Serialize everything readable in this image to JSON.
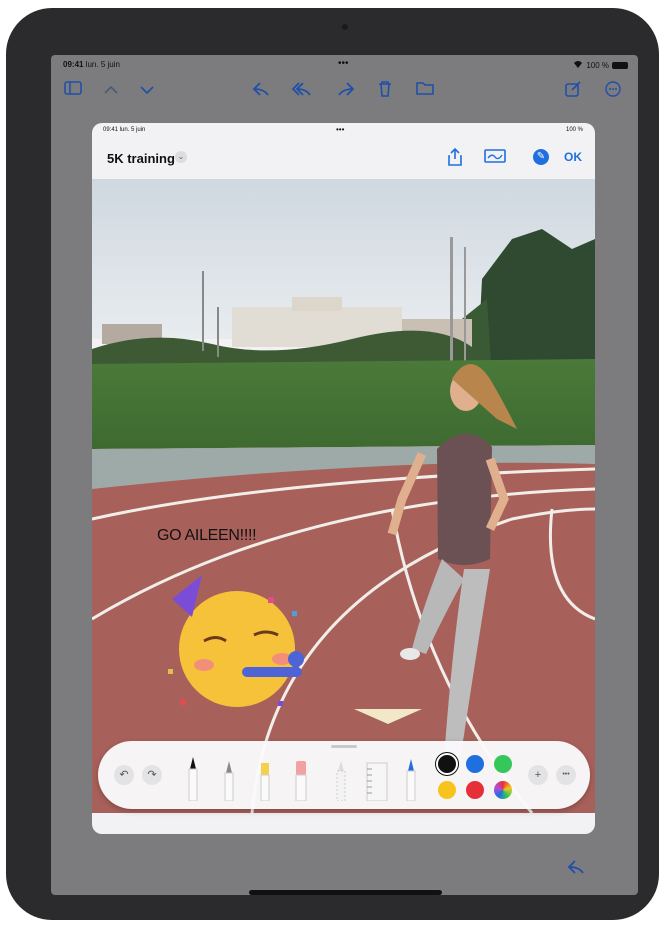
{
  "status_bar": {
    "time": "09:41",
    "date": "lun. 5 juin",
    "dots": "•••",
    "battery": "100 %"
  },
  "mail_toolbar": {
    "icons": [
      "sidebar-icon",
      "chevron-up-icon",
      "chevron-down-icon",
      "reply-icon",
      "reply-all-icon",
      "forward-icon",
      "trash-icon",
      "folder-icon",
      "compose-icon",
      "more-icon"
    ]
  },
  "sheet": {
    "status_time": "09:41",
    "status_date": "lun. 5 juin",
    "status_dots": "•••",
    "status_battery": "100 %",
    "title": "5K training",
    "title_chevron": "⌄",
    "ok_label": "OK"
  },
  "photo": {
    "caption": "GO AILEEN!!!!"
  },
  "palette": {
    "tools": [
      "pen",
      "monoline-marker",
      "highlighter",
      "eraser",
      "lasso",
      "ruler",
      "pencil"
    ],
    "colors": [
      "#111111",
      "#1f6fe0",
      "#34c759",
      "#f6c41c",
      "#e5303a",
      "rainbow"
    ],
    "selected_color": "#111111",
    "plus_label": "+",
    "more_label": "•••"
  },
  "colors": {
    "accent": "#1f6fe0",
    "mail_accent": "#1f4fa8"
  }
}
